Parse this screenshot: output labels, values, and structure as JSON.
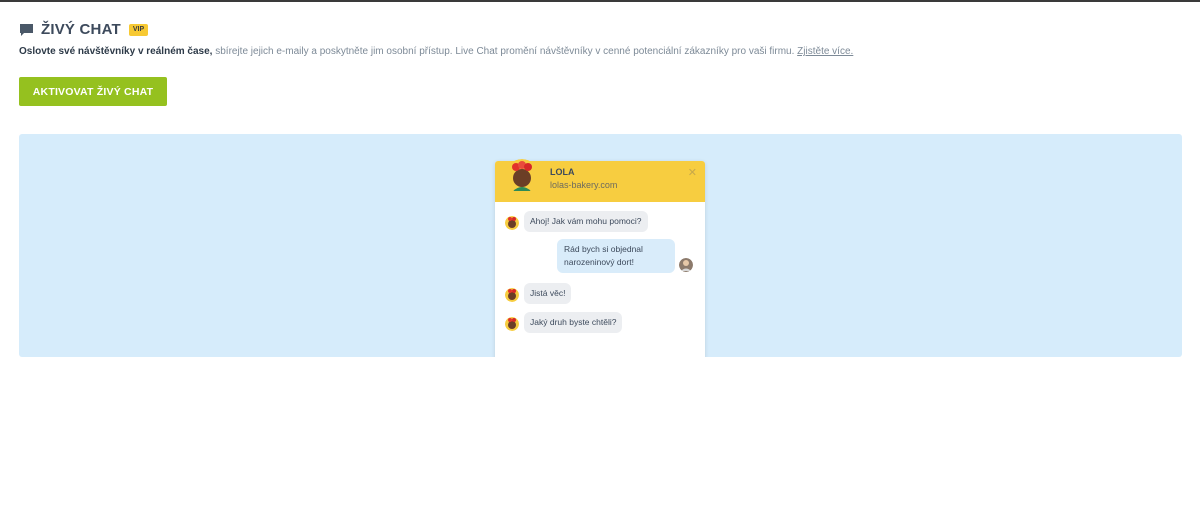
{
  "header": {
    "title": "ŽIVÝ CHAT",
    "badge": "VIP",
    "chat_icon": "chat-bubble-icon"
  },
  "description": {
    "strong": "Oslovte své návštěvníky v reálném čase,",
    "text": " sbírejte jejich e-maily a poskytněte jim osobní přístup. Live Chat promění návštěvníky v cenné potenciální zákazníky pro vaši firmu. ",
    "link": "Zjistěte více."
  },
  "activate_button": "AKTIVOVAT ŽIVÝ CHAT",
  "widget": {
    "name": "LOLA",
    "site": "lolas-bakery.com",
    "close_icon": "close-icon",
    "messages": [
      {
        "from": "agent",
        "text": "Ahoj! Jak vám mohu pomoci?"
      },
      {
        "from": "visitor",
        "line1": "Rád bych si objednal",
        "line2": "narozeninový dort!"
      },
      {
        "from": "agent",
        "text": "Jistá věc!"
      },
      {
        "from": "agent",
        "text": "Jaký druh byste chtěli?"
      }
    ]
  },
  "colors": {
    "accent_green": "#95c11f",
    "widget_header": "#f7cd40",
    "preview_bg": "#d6ecfb",
    "vip_badge": "#f7c933"
  }
}
